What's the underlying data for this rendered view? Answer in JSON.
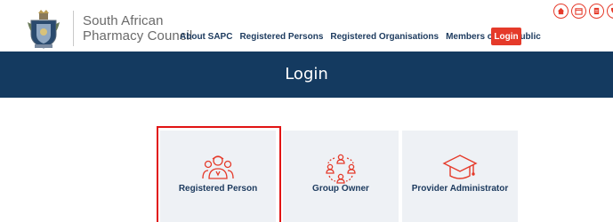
{
  "brand": {
    "name_line1": "South African",
    "name_line2": "Pharmacy Council"
  },
  "nav": {
    "items": [
      {
        "label": "About SAPC"
      },
      {
        "label": "Registered Persons"
      },
      {
        "label": "Registered Organisations"
      },
      {
        "label": "Members of the Public"
      }
    ],
    "login_label": "Login"
  },
  "top_icons": [
    "home-icon",
    "calendar-icon",
    "document-icon",
    "phone-icon"
  ],
  "banner": {
    "title": "Login"
  },
  "cards": [
    {
      "label": "Registered Person",
      "icon": "registered-person-icon",
      "selected": true
    },
    {
      "label": "Group Owner",
      "icon": "group-owner-icon",
      "selected": false
    },
    {
      "label": "Provider Administrator",
      "icon": "graduation-cap-icon",
      "selected": false
    }
  ],
  "colors": {
    "accent": "#e53a2a",
    "navy": "#143a60",
    "nav_text": "#1c3a5e",
    "card_bg": "#eef1f5",
    "selection_border": "#e11414"
  }
}
